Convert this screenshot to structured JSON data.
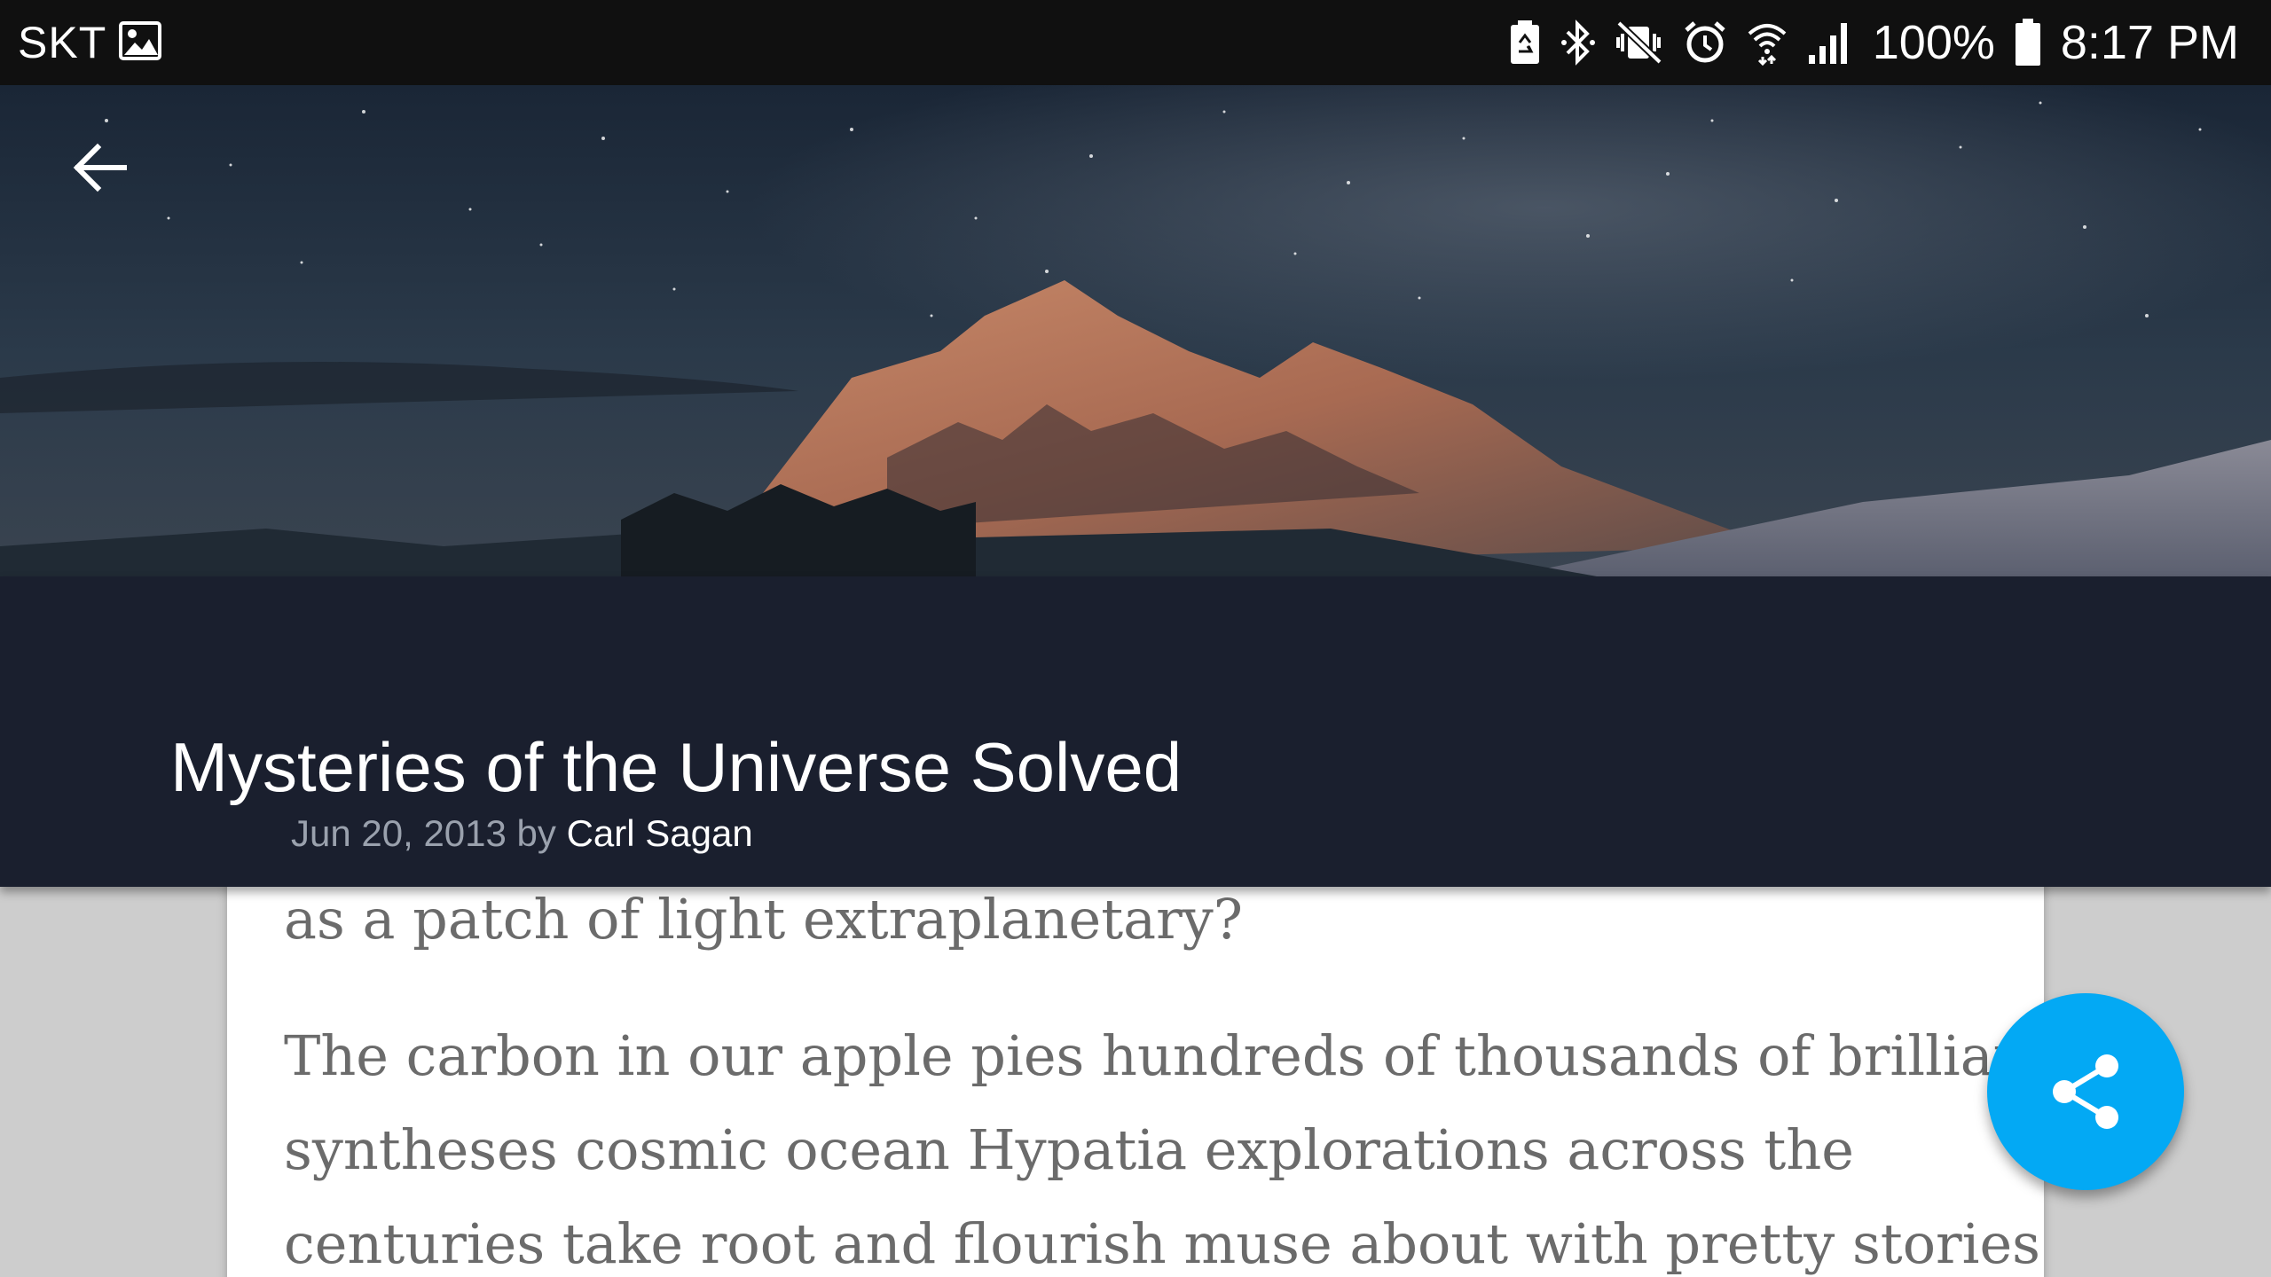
{
  "status_bar": {
    "carrier": "SKT",
    "battery_percent": "100%",
    "time": "8:17 PM",
    "icons": [
      "image-icon",
      "battery-saver-icon",
      "bluetooth-icon",
      "vibrate-mute-icon",
      "alarm-icon",
      "wifi-icon",
      "signal-icon",
      "battery-icon"
    ]
  },
  "toolbar": {
    "back_icon": "arrow-back-icon"
  },
  "article": {
    "title": "Mysteries of the Universe Solved",
    "date": "Jun 20, 2013",
    "by": "by",
    "author": "Carl Sagan",
    "paragraph_partial": "as a patch of light extraplanetary?",
    "paragraph_lines": [
      "The carbon in our apple pies hundreds of thousands of brilliant",
      "syntheses cosmic ocean Hypatia explorations across the",
      "centuries take root and flourish muse about with pretty stories"
    ]
  },
  "fab": {
    "icon": "share-icon"
  },
  "colors": {
    "status_bar": "#101010",
    "title_bar": "#1a1f2e",
    "fab": "#03a9f4",
    "body_text": "#6b6b6b",
    "date_text": "#9aa1ad"
  }
}
